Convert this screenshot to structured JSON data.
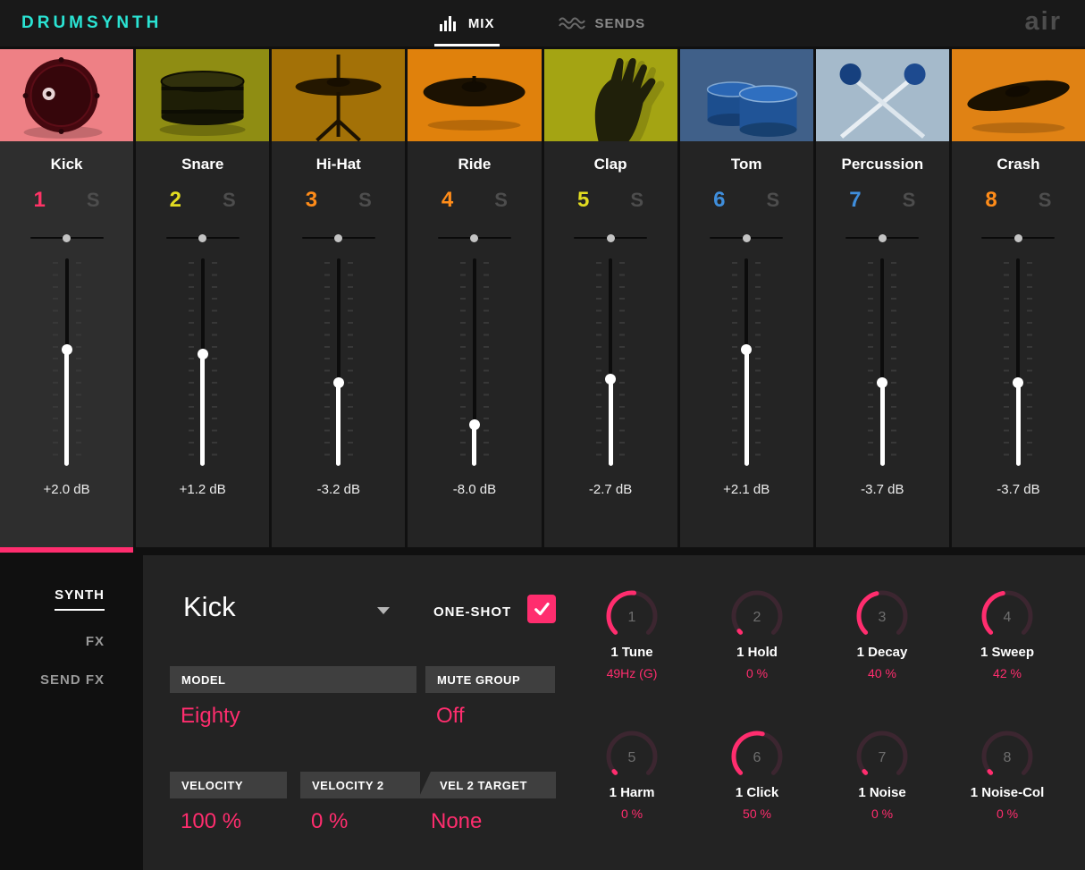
{
  "header": {
    "logo": "DRUMSYNTH",
    "brand": "air",
    "tabs": [
      {
        "label": "MIX",
        "active": true
      },
      {
        "label": "SENDS",
        "active": false
      }
    ]
  },
  "channels": [
    {
      "name": "Kick",
      "number": "1",
      "solo": "S",
      "db": "+2.0 dB",
      "num_color": "#ff3366",
      "thumb_bg": "#ee8085",
      "fader_frac": 0.44,
      "selected": true
    },
    {
      "name": "Snare",
      "number": "2",
      "solo": "S",
      "db": "+1.2 dB",
      "num_color": "#e2dc21",
      "thumb_bg": "#8f8d13",
      "fader_frac": 0.46,
      "selected": false
    },
    {
      "name": "Hi-Hat",
      "number": "3",
      "solo": "S",
      "db": "-3.2 dB",
      "num_color": "#ff8c19",
      "thumb_bg": "#a37107",
      "fader_frac": 0.6,
      "selected": false
    },
    {
      "name": "Ride",
      "number": "4",
      "solo": "S",
      "db": "-8.0 dB",
      "num_color": "#ff8c19",
      "thumb_bg": "#e0810c",
      "fader_frac": 0.8,
      "selected": false
    },
    {
      "name": "Clap",
      "number": "5",
      "solo": "S",
      "db": "-2.7 dB",
      "num_color": "#e2dc21",
      "thumb_bg": "#a4a413",
      "fader_frac": 0.58,
      "selected": false
    },
    {
      "name": "Tom",
      "number": "6",
      "solo": "S",
      "db": "+2.1 dB",
      "num_color": "#3f8edc",
      "thumb_bg": "#406089",
      "fader_frac": 0.44,
      "selected": false
    },
    {
      "name": "Percussion",
      "number": "7",
      "solo": "S",
      "db": "-3.7 dB",
      "num_color": "#3f8edc",
      "thumb_bg": "#a5bacb",
      "fader_frac": 0.6,
      "selected": false
    },
    {
      "name": "Crash",
      "number": "8",
      "solo": "S",
      "db": "-3.7 dB",
      "num_color": "#ff8c19",
      "thumb_bg": "#e08214",
      "fader_frac": 0.6,
      "selected": false
    }
  ],
  "sidebar": {
    "items": [
      {
        "label": "SYNTH",
        "active": true
      },
      {
        "label": "FX",
        "active": false
      },
      {
        "label": "SEND FX",
        "active": false
      }
    ]
  },
  "editor": {
    "preset_name": "Kick",
    "one_shot_label": "ONE-SHOT",
    "one_shot_checked": true,
    "fields": {
      "model": {
        "label": "MODEL",
        "value": "Eighty"
      },
      "mute_group": {
        "label": "MUTE GROUP",
        "value": "Off"
      },
      "velocity": {
        "label": "VELOCITY",
        "value": "100 %"
      },
      "velocity2": {
        "label": "VELOCITY 2",
        "value": "0 %"
      },
      "vel2_target": {
        "label": "VEL 2 TARGET",
        "value": "None"
      }
    },
    "knobs": [
      {
        "number": "1",
        "label": "1 Tune",
        "value": "49Hz (G)",
        "percent": 52
      },
      {
        "number": "2",
        "label": "1 Hold",
        "value": "0 %",
        "percent": 2
      },
      {
        "number": "3",
        "label": "1 Decay",
        "value": "40 %",
        "percent": 45
      },
      {
        "number": "4",
        "label": "1 Sweep",
        "value": "42 %",
        "percent": 46
      },
      {
        "number": "5",
        "label": "1 Harm",
        "value": "0 %",
        "percent": 2
      },
      {
        "number": "6",
        "label": "1 Click",
        "value": "50 %",
        "percent": 55
      },
      {
        "number": "7",
        "label": "1 Noise",
        "value": "0 %",
        "percent": 2
      },
      {
        "number": "8",
        "label": "1 Noise-Col",
        "value": "0 %",
        "percent": 2
      }
    ]
  },
  "colors": {
    "accent_pink": "#ff2d6e",
    "logo_teal": "#2ae3d3"
  }
}
